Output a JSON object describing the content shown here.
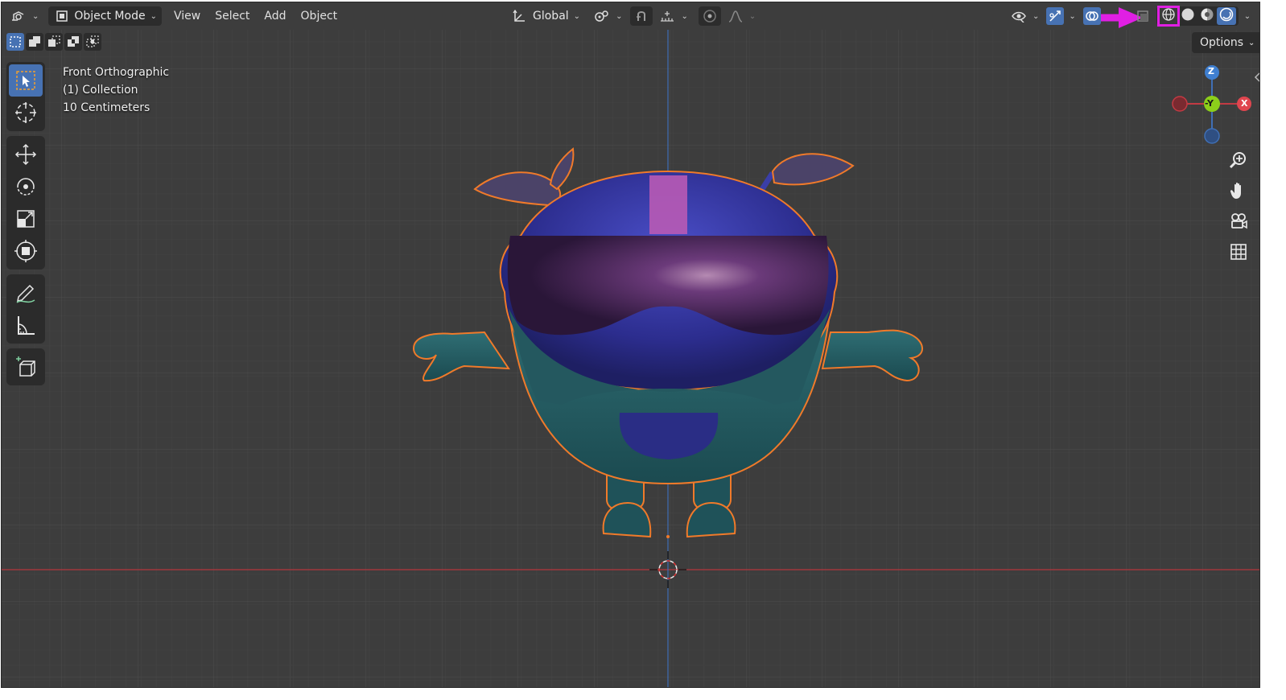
{
  "header": {
    "mode_label": "Object Mode",
    "menus": [
      "View",
      "Select",
      "Add",
      "Object"
    ],
    "orientation_label": "Global"
  },
  "viewport": {
    "view_name": "Front Orthographic",
    "collection": "(1) Collection",
    "scale": "10 Centimeters",
    "options_label": "Options"
  },
  "gizmo": {
    "z_label": "Z",
    "y_label": "-Y",
    "x_label": "X"
  },
  "colors": {
    "background": "#3d3d3d",
    "grid": "#474747",
    "accent_blue": "#4772b3",
    "selection_outline": "#f07a2a",
    "annotation_magenta": "#e01fe3",
    "axis_red": "#b5353d",
    "axis_blue": "#3f6fb5"
  },
  "icons": {
    "editor_type": "editor-type-icon",
    "shading_wireframe": "wireframe-shading-icon",
    "shading_solid": "solid-shading-icon",
    "shading_material": "material-preview-icon",
    "shading_rendered": "rendered-shading-icon"
  }
}
